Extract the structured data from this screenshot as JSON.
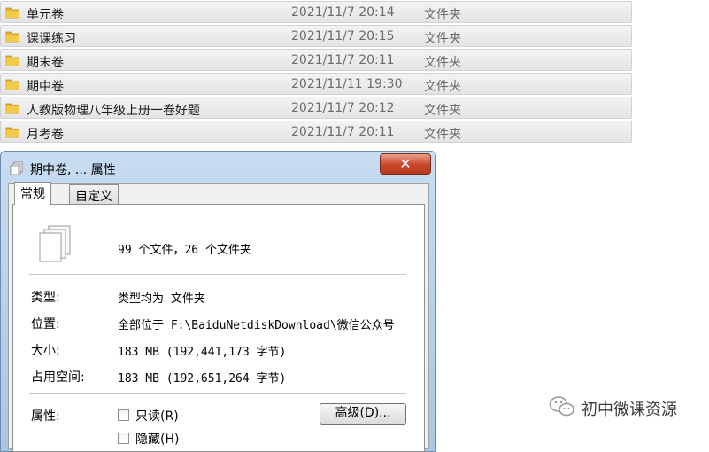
{
  "files": [
    {
      "name": "单元卷",
      "date": "2021/11/7 20:14",
      "type": "文件夹"
    },
    {
      "name": "课课练习",
      "date": "2021/11/7 20:15",
      "type": "文件夹"
    },
    {
      "name": "期末卷",
      "date": "2021/11/7 20:11",
      "type": "文件夹"
    },
    {
      "name": "期中卷",
      "date": "2021/11/11 19:30",
      "type": "文件夹"
    },
    {
      "name": "人教版物理八年级上册一卷好题",
      "date": "2021/11/7 20:12",
      "type": "文件夹"
    },
    {
      "name": "月考卷",
      "date": "2021/11/7 20:11",
      "type": "文件夹"
    }
  ],
  "dialog": {
    "title": "期中卷, ... 属性",
    "close_label": "✕",
    "tabs": [
      "常规",
      "自定义"
    ],
    "summary": "99 个文件，26 个文件夹",
    "props": {
      "type_label": "类型:",
      "type_value": "类型均为 文件夹",
      "location_label": "位置:",
      "location_value": "全部位于 F:\\BaiduNetdiskDownload\\微信公众号",
      "size_label": "大小:",
      "size_value": "183 MB (192,441,173 字节)",
      "disk_label": "占用空间:",
      "disk_value": "183 MB (192,651,264 字节)",
      "attr_label": "属性:"
    },
    "attributes": [
      {
        "label": "只读(R)",
        "checked": false
      },
      {
        "label": "隐藏(H)",
        "checked": false
      }
    ],
    "advanced_label": "高级(D)..."
  },
  "watermark": {
    "text": "初中微课资源",
    "icon": "wechat-logo-icon"
  },
  "colors": {
    "folder": "#e8b630",
    "dialog_frame": "#b4cde9",
    "close_button": "#c9452a"
  }
}
